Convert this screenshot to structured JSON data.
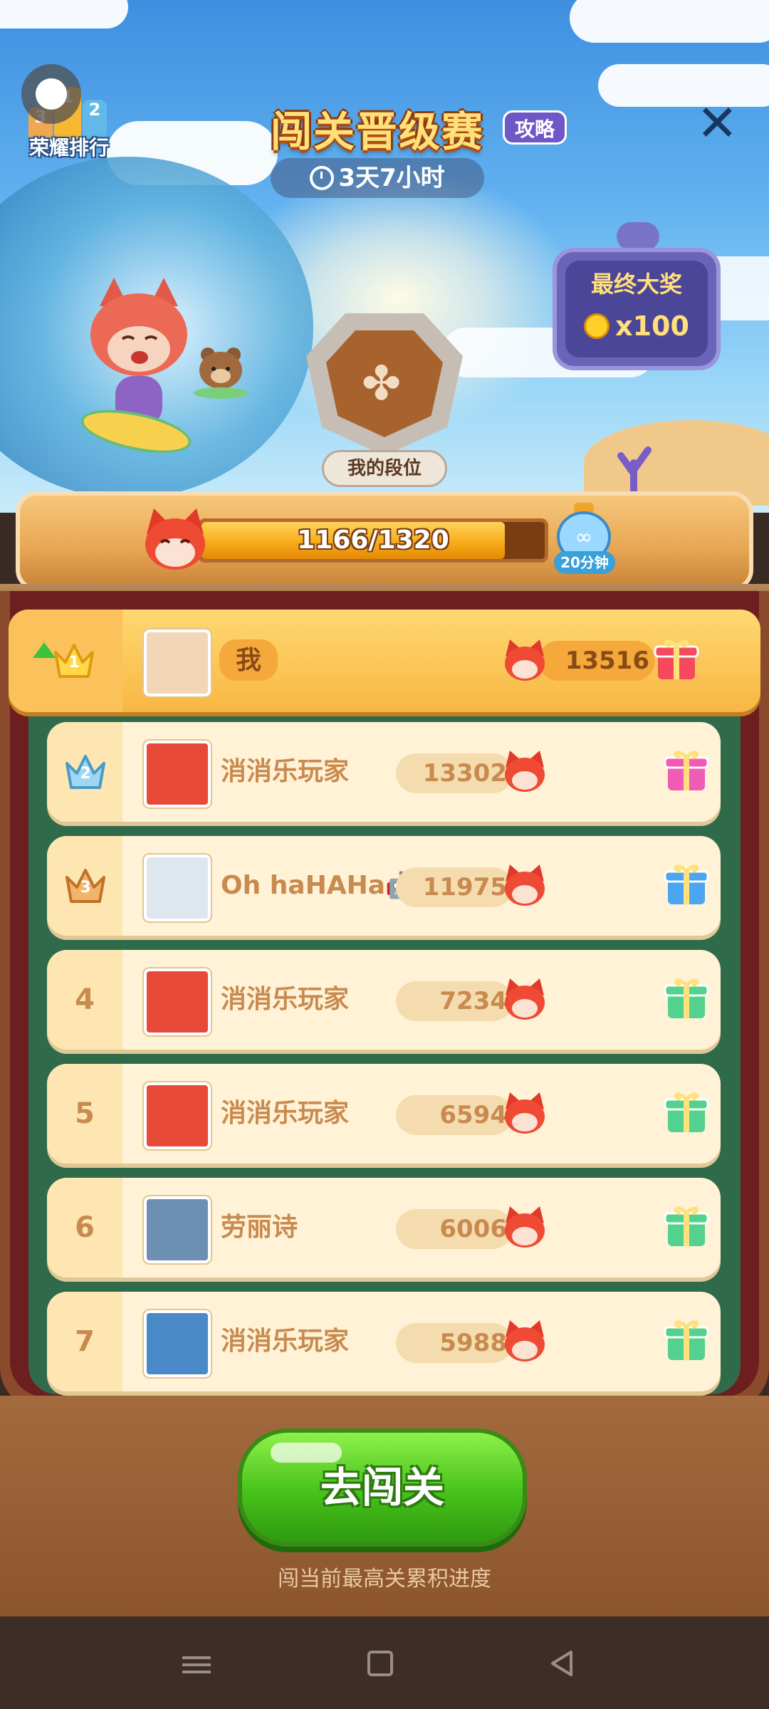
{
  "header": {
    "rank_label": "荣耀排行",
    "podium": [
      "3",
      "1",
      "2"
    ],
    "event_title": "闯关晋级赛",
    "guide_label": "攻略",
    "timer": "3天7小时",
    "close_icon": "close-icon"
  },
  "final_prize": {
    "title": "最终大奖",
    "count": "x100",
    "icon": "coin-icon"
  },
  "my_rank": {
    "button_label": "我的段位",
    "icon": "clover-shield-icon"
  },
  "progress": {
    "text": "1166/1320",
    "current": 1166,
    "total": 1320,
    "booster_label": "20分钟"
  },
  "leaderboard": [
    {
      "rank": "1",
      "name": "我",
      "score": "13516",
      "crown": "gold",
      "me": true
    },
    {
      "rank": "2",
      "name": "消消乐玩家",
      "score": "13302",
      "crown": "silver"
    },
    {
      "rank": "3",
      "name": "Oh haHAHa🤖",
      "score": "11975",
      "crown": "bronze"
    },
    {
      "rank": "4",
      "name": "消消乐玩家",
      "score": "7234"
    },
    {
      "rank": "5",
      "name": "消消乐玩家",
      "score": "6594"
    },
    {
      "rank": "6",
      "name": "劳丽诗",
      "score": "6006"
    },
    {
      "rank": "7",
      "name": "消消乐玩家",
      "score": "5988"
    }
  ],
  "action": {
    "go_label": "去闯关",
    "hint": "闯当前最高关累积进度"
  },
  "colors": {
    "accent_green": "#46c21a",
    "wood": "#e8a956",
    "board_green": "#2f6b4a"
  }
}
